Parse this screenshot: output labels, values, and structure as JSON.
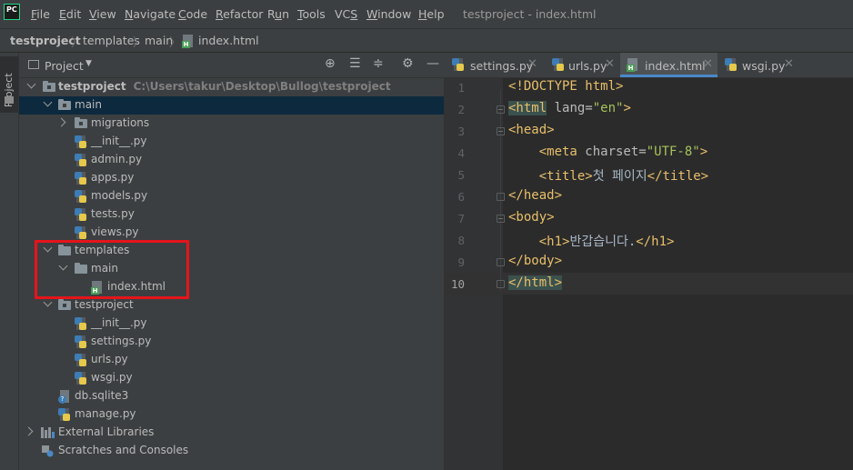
{
  "menubar": {
    "logo": "PC",
    "items": [
      {
        "pre": "",
        "u": "F",
        "post": "ile"
      },
      {
        "pre": "",
        "u": "E",
        "post": "dit"
      },
      {
        "pre": "",
        "u": "V",
        "post": "iew"
      },
      {
        "pre": "",
        "u": "N",
        "post": "avigate"
      },
      {
        "pre": "",
        "u": "C",
        "post": "ode"
      },
      {
        "pre": "",
        "u": "R",
        "post": "efactor"
      },
      {
        "pre": "R",
        "u": "u",
        "post": "n"
      },
      {
        "pre": "",
        "u": "T",
        "post": "ools"
      },
      {
        "pre": "VC",
        "u": "S",
        "post": ""
      },
      {
        "pre": "",
        "u": "W",
        "post": "indow"
      },
      {
        "pre": "",
        "u": "H",
        "post": "elp"
      }
    ],
    "window_title": "testproject - index.html"
  },
  "breadcrumb": [
    "testproject",
    "templates",
    "main",
    "index.html"
  ],
  "stripe": {
    "label": "Project"
  },
  "panel": {
    "title": "Project",
    "tree": [
      {
        "label": "testproject",
        "path": "C:\\Users\\takur\\Desktop\\Bullog\\testproject"
      },
      {
        "label": "main"
      },
      {
        "label": "migrations"
      },
      {
        "label": "__init__.py"
      },
      {
        "label": "admin.py"
      },
      {
        "label": "apps.py"
      },
      {
        "label": "models.py"
      },
      {
        "label": "tests.py"
      },
      {
        "label": "views.py"
      },
      {
        "label": "templates"
      },
      {
        "label": "main"
      },
      {
        "label": "index.html"
      },
      {
        "label": "testproject"
      },
      {
        "label": "__init__.py"
      },
      {
        "label": "settings.py"
      },
      {
        "label": "urls.py"
      },
      {
        "label": "wsgi.py"
      },
      {
        "label": "db.sqlite3"
      },
      {
        "label": "manage.py"
      },
      {
        "label": "External Libraries"
      },
      {
        "label": "Scratches and Consoles"
      }
    ]
  },
  "tabs": [
    {
      "label": "settings.py"
    },
    {
      "label": "urls.py"
    },
    {
      "label": "index.html"
    },
    {
      "label": "wsgi.py"
    }
  ],
  "editor": {
    "line_numbers": [
      "1",
      "2",
      "3",
      "4",
      "5",
      "6",
      "7",
      "8",
      "9",
      "10"
    ],
    "lines": {
      "l1": "<!DOCTYPE html>",
      "l2_tag_open": "<html",
      "l2_attr": " lang=",
      "l2_val": "\"en\"",
      "l2_close": ">",
      "l3": "<head>",
      "l4_tag": "    <meta",
      "l4_attr": " charset=",
      "l4_val": "\"UTF-8\"",
      "l4_close": ">",
      "l5_open": "    <title>",
      "l5_text": "첫 페이지",
      "l5_close": "</title>",
      "l6": "</head>",
      "l7": "<body>",
      "l8_open": "    <h1>",
      "l8_text": "반갑습니다.",
      "l8_close": "</h1>",
      "l9": "</body>",
      "l10": "</html>"
    }
  },
  "colors": {
    "selection_row": "#0d293e",
    "highlight_box": "#e5141b",
    "tag": "#e8bf6a",
    "attr_value": "#a5c25c",
    "active_tab_underline": "#4a88c7"
  }
}
